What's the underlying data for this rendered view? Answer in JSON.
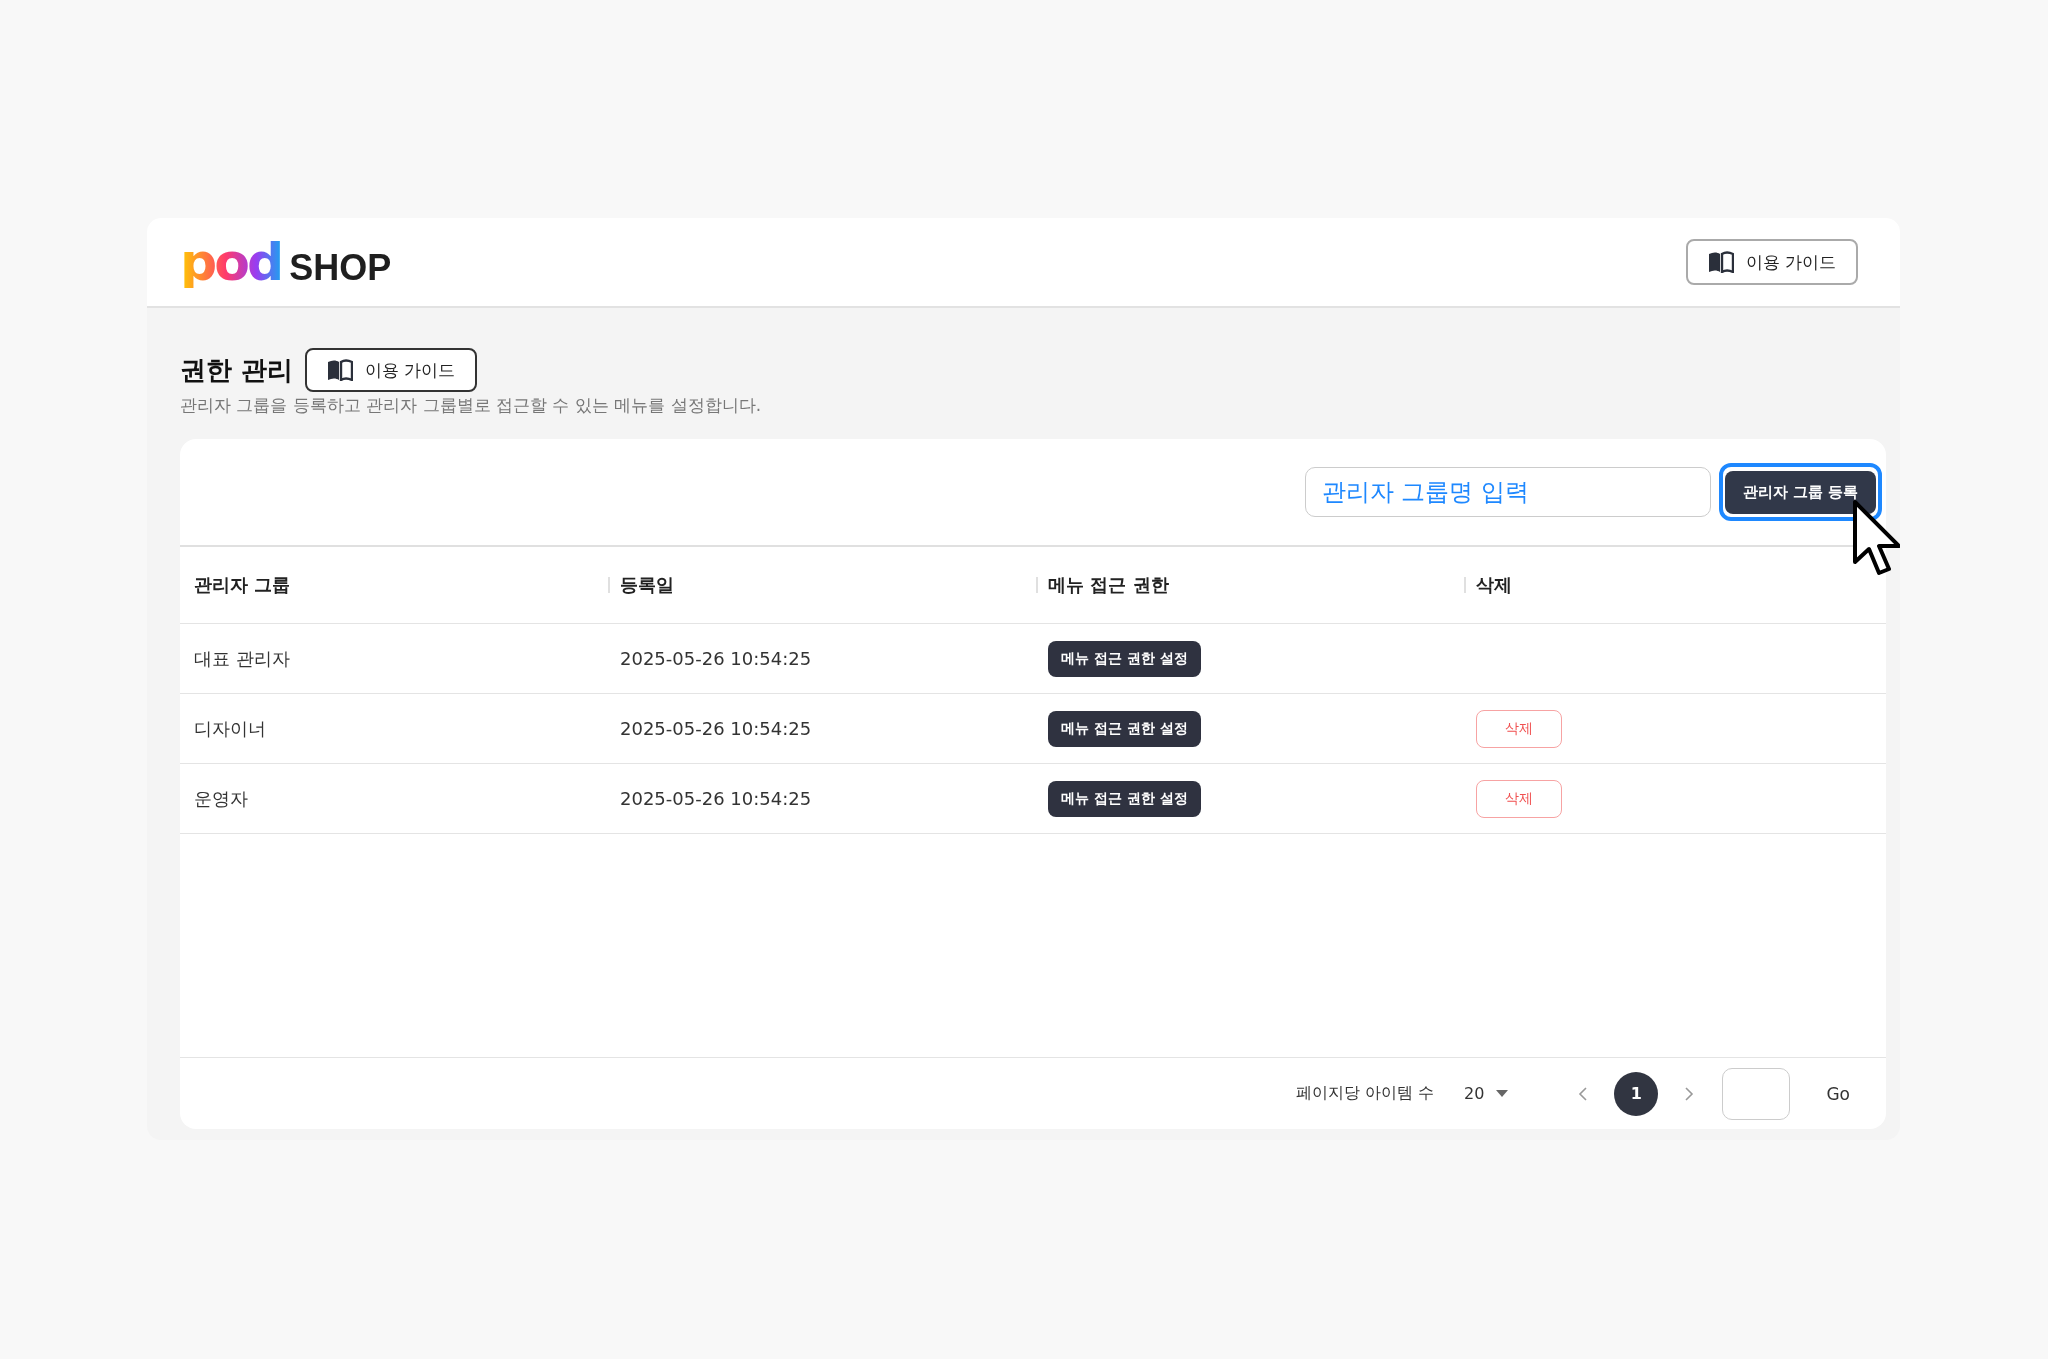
{
  "header": {
    "logo": {
      "mark": "pod",
      "word": "SHOP"
    },
    "guide_button": "이용 가이드"
  },
  "page": {
    "title": "권한 관리",
    "guide_button": "이용 가이드",
    "description": "관리자 그룹을 등록하고 관리자 그룹별로 접근할 수 있는 메뉴를 설정합니다."
  },
  "toolbar": {
    "search": {
      "placeholder": "관리자 그룹명 입력"
    },
    "add_button": "관리자 그룹 등록",
    "add_button_focused": true
  },
  "table": {
    "columns": [
      "관리자 그룹",
      "등록일",
      "메뉴 접근 권한",
      "삭제"
    ],
    "rows": [
      {
        "group": "대표 관리자",
        "date": "2025-05-26 10:54:25",
        "permission_button": "메뉴 접근 권한 설정"
      },
      {
        "group": "디자이너",
        "date": "2025-05-26 10:54:25",
        "permission_button": "메뉴 접근 권한 설정",
        "delete_button": "삭제"
      },
      {
        "group": "운영자",
        "date": "2025-05-26 10:54:25",
        "permission_button": "메뉴 접근 권한 설정",
        "delete_button": "삭제"
      }
    ]
  },
  "pagination": {
    "per_page_label": "페이지당 아이템 수",
    "per_page": "20",
    "pages": [
      {
        "label": "1",
        "selected": true
      }
    ],
    "go_button": "Go"
  }
}
